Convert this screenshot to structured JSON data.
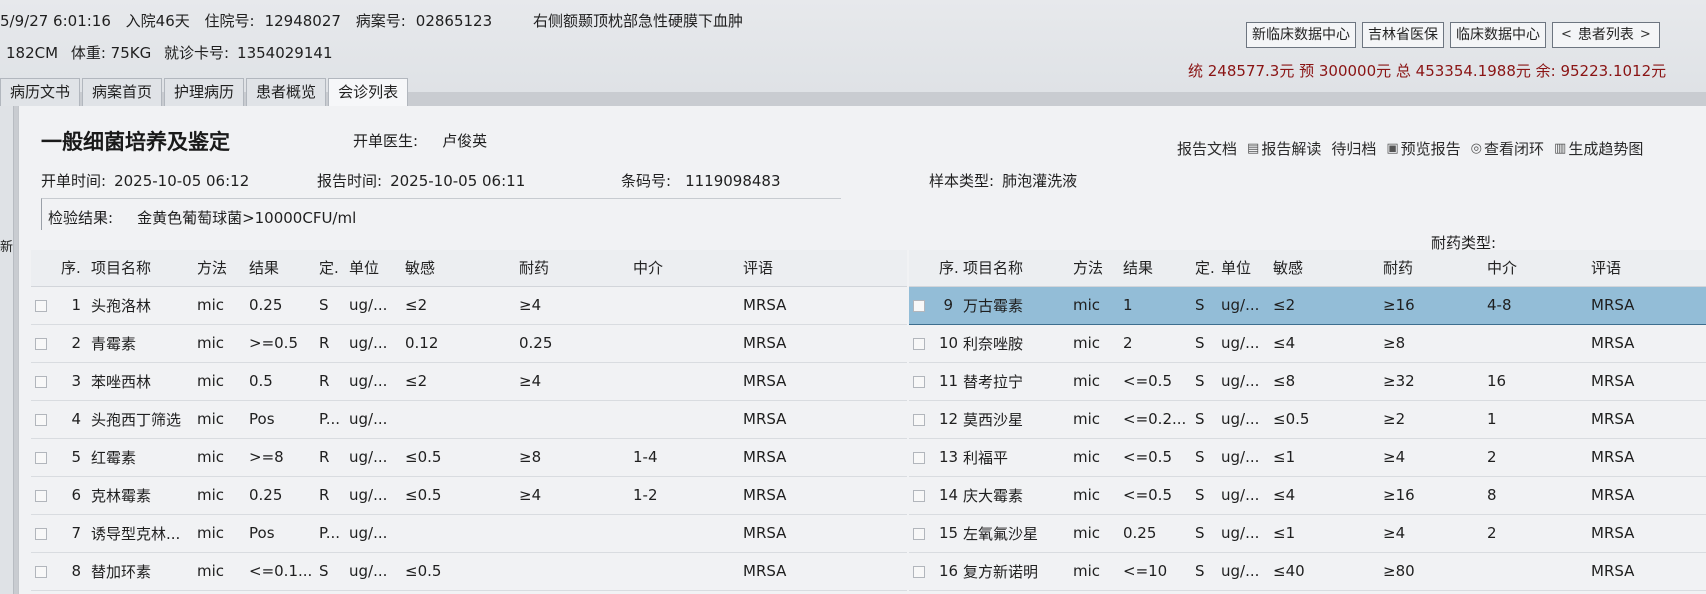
{
  "header": {
    "datetime": "5/9/27 6:01:16",
    "admit_days": "入院46天",
    "inpatient_label": "住院号:",
    "inpatient_no": "12948027",
    "case_label": "病案号:",
    "case_no": "02865123",
    "diagnosis": "右侧额颞顶枕部急性硬膜下血肿",
    "height": "182CM",
    "weight": "体重: 75KG",
    "card_label": "就诊卡号:",
    "card_no": "1354029141",
    "buttons": [
      "新临床数据中心",
      "吉林省医保",
      "临床数据中心",
      "患者列表"
    ],
    "cost_line": "统 248577.3元 预 300000元 总 453354.1988元 余: 95223.1012元"
  },
  "nav_tabs": [
    "病历文书",
    "病案首页",
    "护理病历",
    "患者概览",
    "会诊列表"
  ],
  "sidebar": {
    "label": "新"
  },
  "report": {
    "title": "一般细菌培养及鉴定",
    "doctor_label": "开单医生:",
    "doctor": "卢俊英",
    "actions": [
      {
        "label": "报告文档",
        "icon": ""
      },
      {
        "label": "报告解读",
        "icon": "document-icon"
      },
      {
        "label": "待归档",
        "icon": ""
      },
      {
        "label": "预览报告",
        "icon": "preview-icon"
      },
      {
        "label": "查看闭环",
        "icon": "loop-icon"
      },
      {
        "label": "生成趋势图",
        "icon": "chart-icon"
      }
    ],
    "open_time_label": "开单时间:",
    "open_time": "2025-10-05 06:12",
    "report_time_label": "报告时间:",
    "report_time": "2025-10-05 06:11",
    "barcode_label": "条码号:",
    "barcode": "1119098483",
    "sample_label": "样本类型:",
    "sample": "肺泡灌洗液",
    "result_label": "检验结果:",
    "result": "金黄色葡萄球菌>10000CFU/ml",
    "resist_type_label": "耐药类型:"
  },
  "table_headers": [
    "序.",
    "项目名称",
    "方法",
    "结果",
    "定.",
    "单位",
    "敏感",
    "耐药",
    "中介",
    "评语"
  ],
  "left_rows": [
    [
      "1",
      "头孢洛林",
      "mic",
      "0.25",
      "S",
      "ug/...",
      "≤2",
      "≥4",
      "",
      "MRSA"
    ],
    [
      "2",
      "青霉素",
      "mic",
      ">=0.5",
      "R",
      "ug/...",
      "0.12",
      "0.25",
      "",
      "MRSA"
    ],
    [
      "3",
      "苯唑西林",
      "mic",
      "0.5",
      "R",
      "ug/...",
      "≤2",
      "≥4",
      "",
      "MRSA"
    ],
    [
      "4",
      "头孢西丁筛选",
      "mic",
      "Pos",
      "P...",
      "ug/...",
      "",
      "",
      "",
      "MRSA"
    ],
    [
      "5",
      "红霉素",
      "mic",
      ">=8",
      "R",
      "ug/...",
      "≤0.5",
      "≥8",
      "1-4",
      "MRSA"
    ],
    [
      "6",
      "克林霉素",
      "mic",
      "0.25",
      "R",
      "ug/...",
      "≤0.5",
      "≥4",
      "1-2",
      "MRSA"
    ],
    [
      "7",
      "诱导型克林...",
      "mic",
      "Pos",
      "P...",
      "ug/...",
      "",
      "",
      "",
      "MRSA"
    ],
    [
      "8",
      "替加环素",
      "mic",
      "<=0.1...",
      "S",
      "ug/...",
      "≤0.5",
      "",
      "",
      "MRSA"
    ]
  ],
  "right_rows": [
    [
      "9",
      "万古霉素",
      "mic",
      "1",
      "S",
      "ug/...",
      "≤2",
      "≥16",
      "4-8",
      "MRSA"
    ],
    [
      "10",
      "利奈唑胺",
      "mic",
      "2",
      "S",
      "ug/...",
      "≤4",
      "≥8",
      "",
      "MRSA"
    ],
    [
      "11",
      "替考拉宁",
      "mic",
      "<=0.5",
      "S",
      "ug/...",
      "≤8",
      "≥32",
      "16",
      "MRSA"
    ],
    [
      "12",
      "莫西沙星",
      "mic",
      "<=0.2...",
      "S",
      "ug/...",
      "≤0.5",
      "≥2",
      "1",
      "MRSA"
    ],
    [
      "13",
      "利福平",
      "mic",
      "<=0.5",
      "S",
      "ug/...",
      "≤1",
      "≥4",
      "2",
      "MRSA"
    ],
    [
      "14",
      "庆大霉素",
      "mic",
      "<=0.5",
      "S",
      "ug/...",
      "≤4",
      "≥16",
      "8",
      "MRSA"
    ],
    [
      "15",
      "左氧氟沙星",
      "mic",
      "0.25",
      "S",
      "ug/...",
      "≤1",
      "≥4",
      "2",
      "MRSA"
    ],
    [
      "16",
      "复方新诺明",
      "mic",
      "<=10",
      "S",
      "ug/...",
      "≤40",
      "≥80",
      "",
      "MRSA"
    ]
  ]
}
